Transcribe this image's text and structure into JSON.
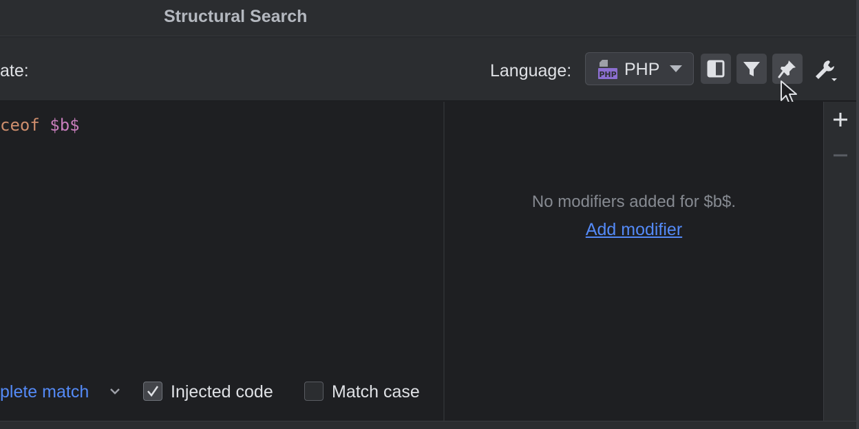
{
  "window": {
    "title": "Structural Search"
  },
  "toolbar": {
    "template_label": "ate:",
    "language_label": "Language:",
    "language_value": "PHP",
    "language_icon": "php-file-icon",
    "buttons": [
      {
        "name": "preview-toggle-button",
        "icon": "split-panel-icon"
      },
      {
        "name": "filter-button",
        "icon": "filter-icon"
      },
      {
        "name": "pin-button",
        "icon": "pin-icon"
      },
      {
        "name": "settings-button",
        "icon": "wrench-icon"
      }
    ]
  },
  "editor": {
    "code_keyword": "ceof",
    "code_variable": "$b$"
  },
  "options": {
    "match_type": "plete match",
    "injected_code": {
      "label": "Injected code",
      "checked": true
    },
    "match_case": {
      "label": "Match case",
      "checked": false
    }
  },
  "modifiers": {
    "empty_text": "No modifiers added for $b$.",
    "add_link": "Add modifier"
  },
  "sidebar": {
    "add_icon": "plus-icon",
    "remove_icon": "minus-icon"
  },
  "colors": {
    "background": "#1e1f22",
    "panel": "#2b2d30",
    "link": "#548af7",
    "keyword": "#cf8e6d",
    "variable": "#c77dbb",
    "php_badge": "#8c6fd1"
  }
}
